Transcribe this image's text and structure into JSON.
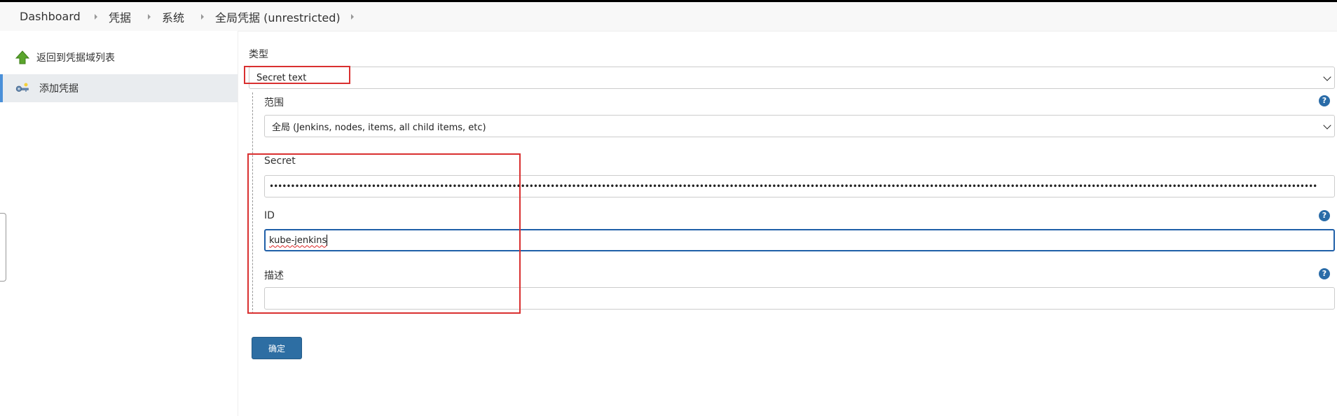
{
  "breadcrumb": {
    "items": [
      "Dashboard",
      "凭据",
      "系统",
      "全局凭据 (unrestricted)"
    ]
  },
  "sidebar": {
    "items": [
      {
        "label": "返回到凭据域列表",
        "icon": "green-up-arrow-icon"
      },
      {
        "label": "添加凭据",
        "icon": "key-icon"
      }
    ]
  },
  "form": {
    "kind_label": "类型",
    "kind_value": "Secret text",
    "scope_label": "范围",
    "scope_value": "全局 (Jenkins, nodes, items, all child items, etc)",
    "secret_label": "Secret",
    "secret_value": "••••••••••••••••••••••••••••••••••••••••••••••••••••••••••••••••••••••••••••••••••••••••••••••••••••••••••••••••••••••••••••••••••••••••••••••••••••••••••••••••••••••••••••••••••••••••••••••••••••••••••••••••••••••••••••••••••••••••••••••••••••••",
    "id_label": "ID",
    "id_value": "kube-jenkins",
    "description_label": "描述",
    "description_value": "",
    "help_symbol": "?",
    "submit_label": "确定"
  },
  "colors": {
    "accent": "#2d6ea3",
    "annotation": "#d93030",
    "focus": "#1f5fa8"
  }
}
